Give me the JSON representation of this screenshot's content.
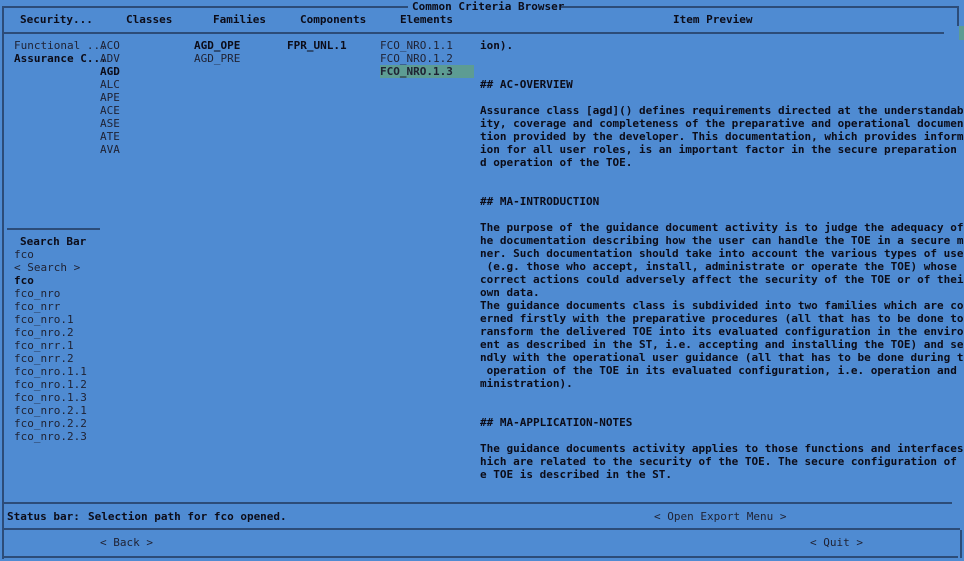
{
  "window": {
    "title": "Common Criteria Browser"
  },
  "headers": {
    "security": "Security...",
    "classes": "Classes",
    "families": "Families",
    "components": "Components",
    "elements": "Elements",
    "preview": "Item Preview"
  },
  "security_items": [
    {
      "label": "Functional ...",
      "bold": false
    },
    {
      "label": "Assurance C...",
      "bold": true
    }
  ],
  "classes": [
    {
      "label": "ACO",
      "bold": false
    },
    {
      "label": "ADV",
      "bold": false
    },
    {
      "label": "AGD",
      "bold": true
    },
    {
      "label": "ALC",
      "bold": false
    },
    {
      "label": "APE",
      "bold": false
    },
    {
      "label": "ACE",
      "bold": false
    },
    {
      "label": "ASE",
      "bold": false
    },
    {
      "label": "ATE",
      "bold": false
    },
    {
      "label": "AVA",
      "bold": false
    }
  ],
  "families": [
    {
      "label": "AGD_OPE",
      "bold": true
    },
    {
      "label": "AGD_PRE",
      "bold": false
    }
  ],
  "components": [
    {
      "label": "FPR_UNL.1",
      "bold": true
    }
  ],
  "elements": [
    {
      "label": "FCO_NRO.1.1",
      "selected": false
    },
    {
      "label": "FCO_NRO.1.2",
      "selected": false
    },
    {
      "label": "FCO_NRO.1.3",
      "selected": true
    }
  ],
  "search": {
    "title": "Search Bar",
    "input_value": "fco",
    "button_label": "< Search >",
    "results": [
      {
        "label": "fco",
        "bold": true
      },
      {
        "label": "fco_nro",
        "bold": false
      },
      {
        "label": "fco_nrr",
        "bold": false
      },
      {
        "label": "fco_nro.1",
        "bold": false
      },
      {
        "label": "fco_nro.2",
        "bold": false
      },
      {
        "label": "fco_nrr.1",
        "bold": false
      },
      {
        "label": "fco_nrr.2",
        "bold": false
      },
      {
        "label": "fco_nro.1.1",
        "bold": false
      },
      {
        "label": "fco_nro.1.2",
        "bold": false
      },
      {
        "label": "fco_nro.1.3",
        "bold": false
      },
      {
        "label": "fco_nro.2.1",
        "bold": false
      },
      {
        "label": "fco_nro.2.2",
        "bold": false
      },
      {
        "label": "fco_nro.2.3",
        "bold": false
      }
    ]
  },
  "preview_lines": [
    "ion).",
    "",
    "",
    "## AC-OVERVIEW",
    "",
    "Assurance class [agd]() defines requirements directed at the understandabil",
    "ity, coverage and completeness of the preparative and operational documenta",
    "tion provided by the developer. This documentation, which provides informat",
    "ion for all user roles, is an important factor in the secure preparation an",
    "d operation of the TOE.",
    "",
    "",
    "## MA-INTRODUCTION",
    "",
    "The purpose of the guidance document activity is to judge the adequacy of t",
    "he documentation describing how the user can handle the TOE in a secure man",
    "ner. Such documentation should take into account the various types of users",
    " (e.g. those who accept, install, administrate or operate the TOE) whose in",
    "correct actions could adversely affect the security of the TOE or of their",
    "own data.",
    "The guidance documents class is subdivided into two families which are conc",
    "erned firstly with the preparative procedures (all that has to be done to t",
    "ransform the delivered TOE into its evaluated configuration in the environm",
    "ent as described in the ST, i.e. accepting and installing the TOE) and seco",
    "ndly with the operational user guidance (all that has to be done during the",
    " operation of the TOE in its evaluated configuration, i.e. operation and ad",
    "ministration).",
    "",
    "",
    "## MA-APPLICATION-NOTES",
    "",
    "The guidance documents activity applies to those functions and interfaces w",
    "hich are related to the security of the TOE. The secure configuration of th",
    "e TOE is described in the ST."
  ],
  "status": {
    "label": "Status bar:",
    "message": "Selection path for fco opened."
  },
  "buttons": {
    "export": "< Open Export Menu >",
    "back": "< Back >",
    "quit": "< Quit >"
  },
  "colors": {
    "background": "#4f8bd2",
    "selection": "#5d9c93",
    "border": "#2c4c78"
  }
}
